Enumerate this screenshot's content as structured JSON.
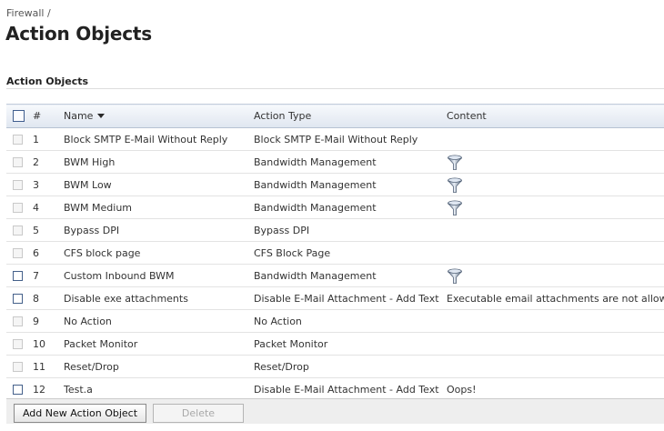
{
  "breadcrumb": "Firewall /",
  "page_title": "Action Objects",
  "section_title": "Action Objects",
  "table": {
    "headers": {
      "num": "#",
      "name": "Name",
      "type": "Action Type",
      "content": "Content"
    },
    "rows": [
      {
        "num": "1",
        "name": "Block SMTP E-Mail Without Reply",
        "type": "Block SMTP E-Mail Without Reply",
        "content": "",
        "checkbox_enabled": false,
        "icon": ""
      },
      {
        "num": "2",
        "name": "BWM High",
        "type": "Bandwidth Management",
        "content": "",
        "checkbox_enabled": false,
        "icon": "funnel-icon"
      },
      {
        "num": "3",
        "name": "BWM Low",
        "type": "Bandwidth Management",
        "content": "",
        "checkbox_enabled": false,
        "icon": "funnel-icon"
      },
      {
        "num": "4",
        "name": "BWM Medium",
        "type": "Bandwidth Management",
        "content": "",
        "checkbox_enabled": false,
        "icon": "funnel-icon"
      },
      {
        "num": "5",
        "name": "Bypass DPI",
        "type": "Bypass DPI",
        "content": "",
        "checkbox_enabled": false,
        "icon": ""
      },
      {
        "num": "6",
        "name": "CFS block page",
        "type": "CFS Block Page",
        "content": "",
        "checkbox_enabled": false,
        "icon": ""
      },
      {
        "num": "7",
        "name": "Custom Inbound BWM",
        "type": "Bandwidth Management",
        "content": "",
        "checkbox_enabled": true,
        "icon": "funnel-icon"
      },
      {
        "num": "8",
        "name": "Disable exe attachments",
        "type": "Disable E-Mail Attachment - Add Text",
        "content": "Executable email attachments are not allowed.",
        "checkbox_enabled": true,
        "icon": ""
      },
      {
        "num": "9",
        "name": "No Action",
        "type": "No Action",
        "content": "",
        "checkbox_enabled": false,
        "icon": ""
      },
      {
        "num": "10",
        "name": "Packet Monitor",
        "type": "Packet Monitor",
        "content": "",
        "checkbox_enabled": false,
        "icon": ""
      },
      {
        "num": "11",
        "name": "Reset/Drop",
        "type": "Reset/Drop",
        "content": "",
        "checkbox_enabled": false,
        "icon": ""
      },
      {
        "num": "12",
        "name": "Test.a",
        "type": "Disable E-Mail Attachment - Add Text",
        "content": "Oops!",
        "checkbox_enabled": true,
        "icon": ""
      }
    ]
  },
  "buttons": {
    "add": "Add New Action Object",
    "delete": "Delete"
  },
  "colors": {
    "accent": "#3f5d8e",
    "header_bg": "#dfe6f0",
    "row_border": "#e3e3e3"
  }
}
